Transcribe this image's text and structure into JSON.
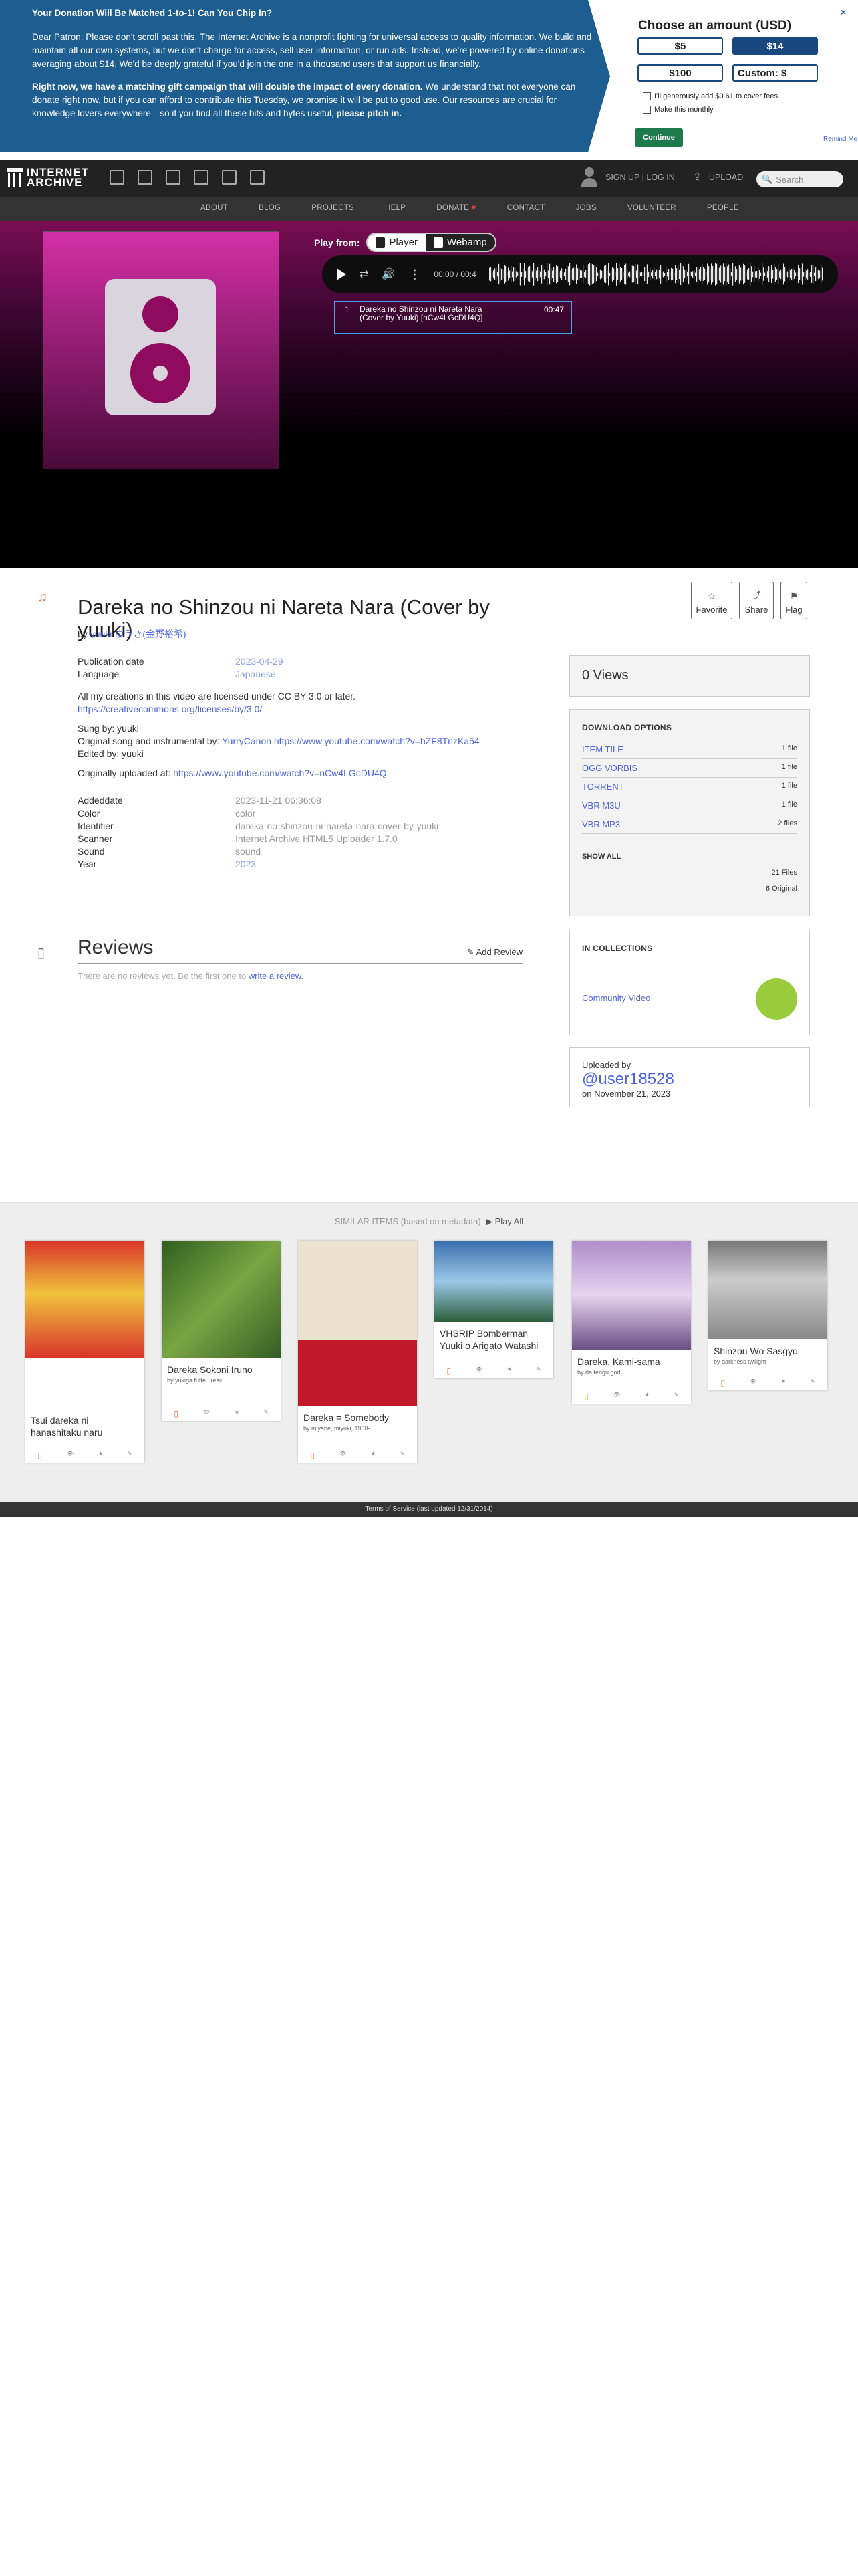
{
  "donate": {
    "heading": "Your Donation Will Be Matched 1-to-1! Can You Chip In?",
    "para1": "Dear Patron: Please don't scroll past this. The Internet Archive is a nonprofit fighting for universal access to quality information. We build and maintain all our own systems, but we don't charge for access, sell user information, or run ads. Instead, we're powered by online donations averaging about $14. We'd be deeply grateful if you'd join the one in a thousand users that support us financially.",
    "para2_bold": "Right now, we have a matching gift campaign that will double the impact of every donation.",
    "para2": " We understand that not everyone can donate right now, but if you can afford to contribute this Tuesday, we promise it will be put to good use. Our resources are crucial for knowledge lovers everywhere—so if you find all these bits and bytes useful, ",
    "para2_end": "please pitch in.",
    "panel_title": "Choose an amount (USD)",
    "amounts": [
      "$5",
      "$14",
      "$100",
      "Custom: $"
    ],
    "fee_label": "I'll generously add $0.61 to cover fees.",
    "monthly_label": "Make this monthly",
    "continue": "Continue",
    "remind": "Remind Me",
    "close": "×"
  },
  "nav": {
    "logo_line1": "INTERNET",
    "logo_line2": "ARCHIVE",
    "signup": "SIGN UP | LOG IN",
    "upload": "UPLOAD",
    "search_placeholder": "Search",
    "subnav": [
      "ABOUT",
      "BLOG",
      "PROJECTS",
      "HELP",
      "DONATE",
      "CONTACT",
      "JOBS",
      "VOLUNTEER",
      "PEOPLE"
    ]
  },
  "theater": {
    "play_from": "Play from:",
    "player_btn": "Player",
    "webamp_btn": "Webamp",
    "time_current": "00:00",
    "time_sep": "/",
    "time_total": "00:4",
    "track": {
      "num": "1",
      "title": "Dareka no Shinzou ni Nareta Nara (Cover by Yuuki) [nCw4LGcDU4Q]",
      "duration": "00:47"
    }
  },
  "item": {
    "title": "Dareka no Shinzou ni Nareta Nara (Cover by yuuki)",
    "by_label": "by",
    "by_value": "yuuki ゆうき(金野裕希)",
    "fields": [
      {
        "k": "Publication date",
        "v": "2023-04-29",
        "link": true
      },
      {
        "k": "Language",
        "v": "Japanese",
        "link": true
      }
    ],
    "desc1": "All my creations in this video are licensed under CC BY 3.0 or later.",
    "desc1_link": "https://creativecommons.org/licenses/by/3.0/",
    "sung": "Sung by: yuuki",
    "orig_label": "Original song and instrumental by: ",
    "orig_link": "YurryCanon https://www.youtube.com/watch?v=hZF8TnzKa54",
    "edited": "Edited by: yuuki",
    "uploaded_label": "Originally uploaded at: ",
    "uploaded_link": "https://www.youtube.com/watch?v=nCw4LGcDU4Q",
    "fields2": [
      {
        "k": "Addeddate",
        "v": "2023-11-21 06:36:08",
        "link": false
      },
      {
        "k": "Color",
        "v": "color",
        "link": false
      },
      {
        "k": "Identifier",
        "v": "dareka-no-shinzou-ni-nareta-nara-cover-by-yuuki",
        "link": false
      },
      {
        "k": "Scanner",
        "v": "Internet Archive HTML5 Uploader 1.7.0",
        "link": false
      },
      {
        "k": "Sound",
        "v": "sound",
        "link": false
      },
      {
        "k": "Year",
        "v": "2023",
        "link": true
      }
    ],
    "actions": [
      "Favorite",
      "Share",
      "Flag"
    ],
    "reviews_title": "Reviews",
    "add_review": "Add Review",
    "no_reviews": "There are no reviews yet. Be the first one to ",
    "no_reviews_link": "write a review."
  },
  "sidebar": {
    "views": "0 Views",
    "download_title": "DOWNLOAD OPTIONS",
    "downloads": [
      {
        "label": "ITEM TILE",
        "count": "1 file"
      },
      {
        "label": "OGG VORBIS",
        "count": "1 file"
      },
      {
        "label": "TORRENT",
        "count": "1 file"
      },
      {
        "label": "VBR M3U",
        "count": "1 file"
      },
      {
        "label": "VBR MP3",
        "count": "2 files"
      }
    ],
    "show_all": "SHOW ALL",
    "total_files": "21 Files",
    "original": "6 Original",
    "collections_title": "IN COLLECTIONS",
    "collection": "Community Video",
    "uploaded_by": "Uploaded by",
    "uploader": "@user18528",
    "uploaded_on": "on November 21, 2023"
  },
  "similar": {
    "heading": "SIMILAR ITEMS (based on metadata)",
    "play_all": "Play All",
    "items": [
      {
        "title": "Tsui dareka ni hanashitaku naru",
        "by": "",
        "stats": [
          "",
          "",
          ""
        ]
      },
      {
        "title": "Dareka Sokoni Iruno",
        "by": "by yukiga futte uresii",
        "stats": [
          "",
          "",
          ""
        ]
      },
      {
        "title": "Dareka = Somebody",
        "by": "by miyabe, miyuki, 1960-",
        "stats": [
          "",
          "",
          ""
        ]
      },
      {
        "title": "VHSRIP Bomberman Yuuki o Arigato Watashi",
        "by": "",
        "stats": [
          "",
          "",
          ""
        ]
      },
      {
        "title": "Dareka, Kami-sama",
        "by": "by da tengu god",
        "stats": [
          "",
          "",
          ""
        ]
      },
      {
        "title": "Shinzou Wo Sasgyo",
        "by": "by darkness twilight",
        "stats": [
          "",
          "",
          ""
        ]
      }
    ]
  },
  "footer": "Terms of Service (last updated 12/31/2014)",
  "colors": {
    "banner": "#1d5d8f",
    "accent": "#194880",
    "link": "#4b64de"
  }
}
